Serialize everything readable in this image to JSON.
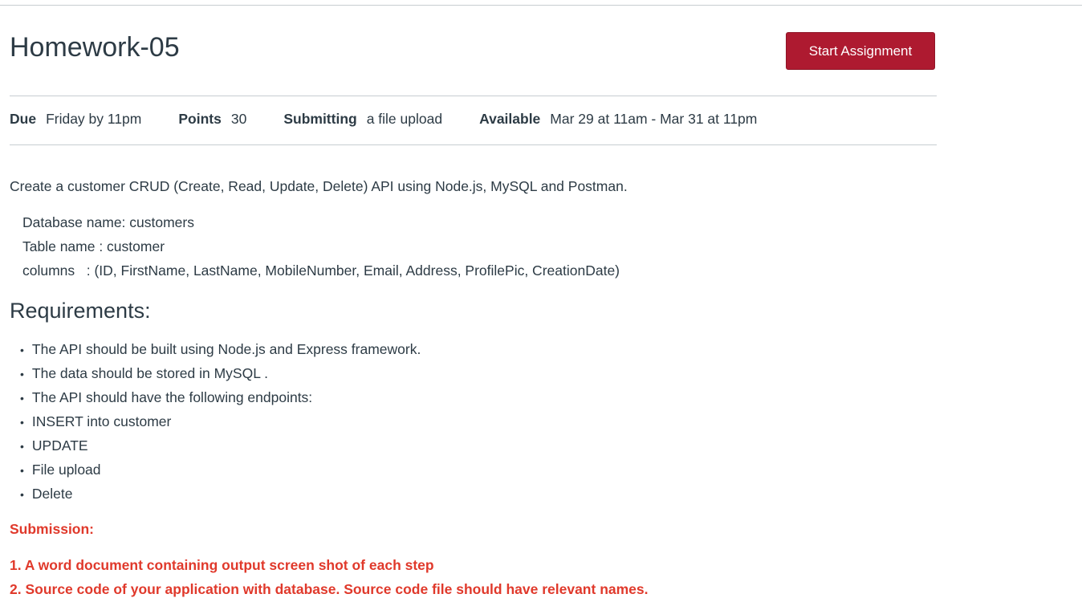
{
  "title": "Homework-05",
  "start_button": "Start Assignment",
  "meta": [
    {
      "label": "Due",
      "value": "Friday by 11pm"
    },
    {
      "label": "Points",
      "value": "30"
    },
    {
      "label": "Submitting",
      "value": "a file upload"
    },
    {
      "label": "Available",
      "value": "Mar 29 at 11am - Mar 31 at 11pm"
    }
  ],
  "description": "Create a customer  CRUD (Create, Read, Update, Delete) API using Node.js, MySQL and Postman.",
  "details": [
    "Database name: customers",
    "Table name : customer",
    "columns   : (ID, FirstName, LastName, MobileNumber, Email, Address, ProfilePic, CreationDate)"
  ],
  "requirements_heading": "Requirements:",
  "requirements": [
    "The API should be built using Node.js and Express framework.",
    "The data should be stored in MySQL .",
    "The API should have the following endpoints:",
    "INSERT into customer",
    "UPDATE",
    "File upload",
    "Delete"
  ],
  "submission_heading": "Submission:",
  "submission_items": [
    "1. A word document containing output screen shot of each step",
    "2. Source code of your application with database. Source code file should have relevant names."
  ],
  "colors": {
    "button": "#ae1a30",
    "submission": "#e0392b"
  }
}
